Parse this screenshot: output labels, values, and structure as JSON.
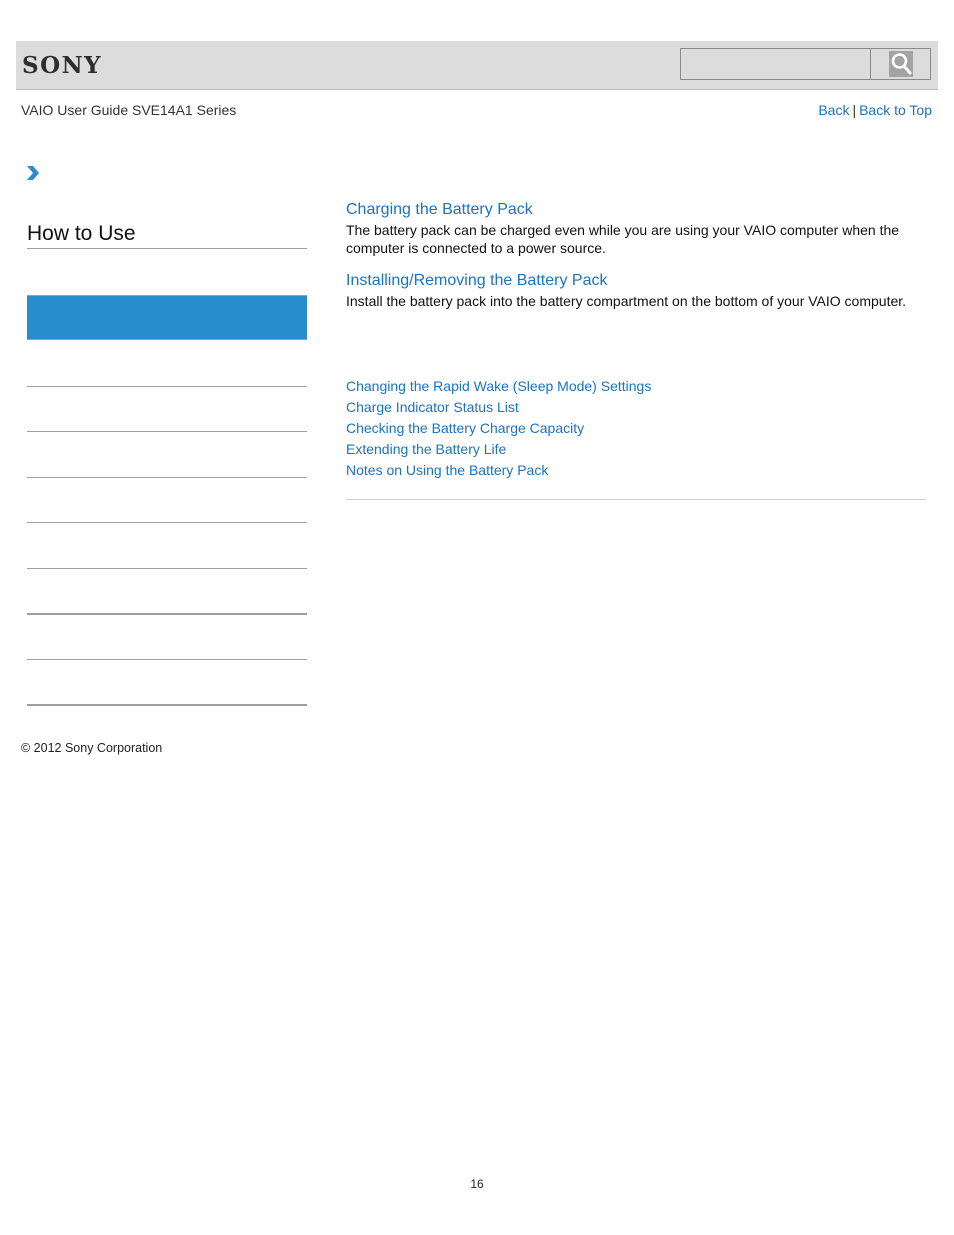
{
  "header": {
    "logo": "SONY",
    "search": {
      "value": "",
      "placeholder": "",
      "button_icon": "search-icon"
    },
    "guide_title": "VAIO User Guide SVE14A1 Series",
    "nav": {
      "back": "Back",
      "separator": "|",
      "back_to_top": "Back to Top"
    }
  },
  "breadcrumb": {
    "icon": "chevron-right-icon"
  },
  "sidebar": {
    "title": "How to Use",
    "active_item_color": "#278dcd",
    "items": [
      "",
      "",
      "",
      "",
      "",
      "",
      "",
      "",
      ""
    ]
  },
  "main": {
    "sections": [
      {
        "title": "Charging the Battery Pack",
        "description": "The battery pack can be charged even while you are using your VAIO computer when the computer is connected to a power source."
      },
      {
        "title": "Installing/Removing the Battery Pack",
        "description": "Install the battery pack into the battery compartment on the bottom of your VAIO computer."
      }
    ],
    "related_links": [
      "Changing the Rapid Wake (Sleep Mode) Settings",
      "Charge Indicator Status List",
      "Checking the Battery Charge Capacity",
      "Extending the Battery Life",
      "Notes on Using the Battery Pack"
    ]
  },
  "footer": {
    "copyright": "© 2012 Sony Corporation",
    "page_number": "16"
  },
  "colors": {
    "link": "#1a73c4",
    "header_bg": "#dcdcdc",
    "accent": "#278dcd"
  }
}
